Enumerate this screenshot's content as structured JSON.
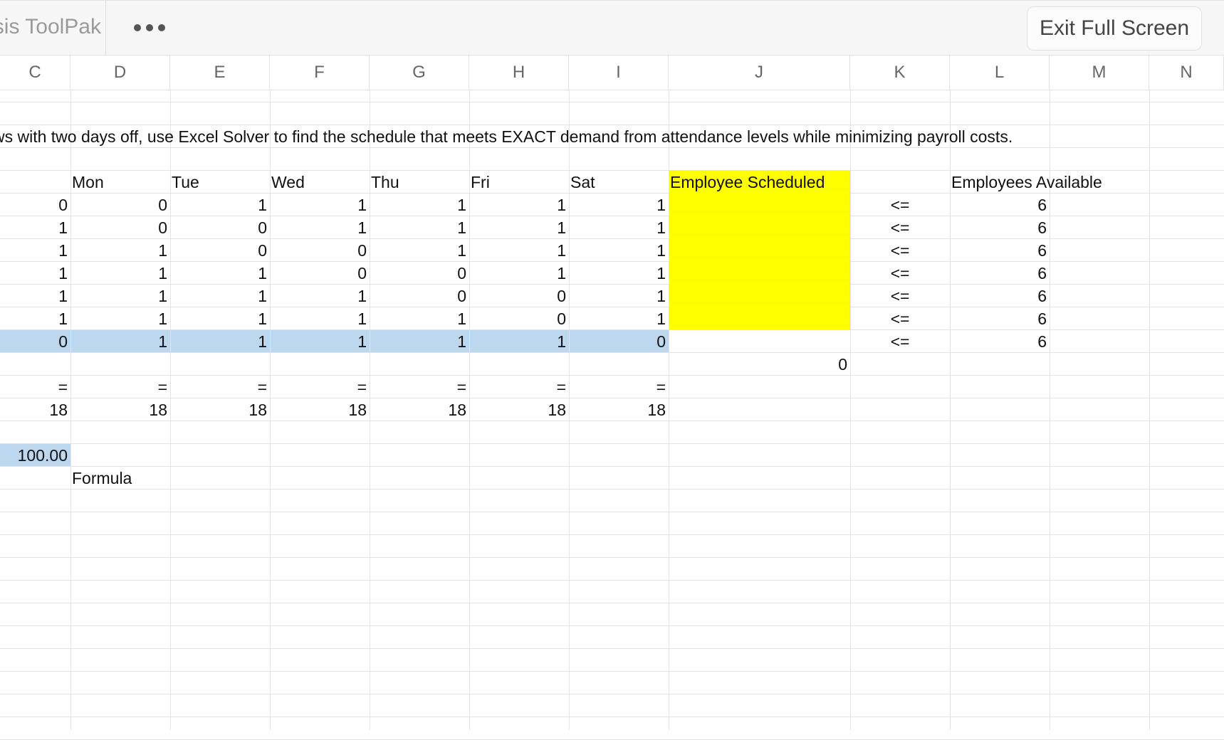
{
  "toolbar": {
    "tab_label": "Analysis ToolPak",
    "more_icon": "ellipsis-icon",
    "exit_full_screen_label": "Exit Full Screen"
  },
  "columns": [
    "C",
    "D",
    "E",
    "F",
    "G",
    "H",
    "I",
    "J",
    "K",
    "L",
    "M",
    "N"
  ],
  "sheet": {
    "instruction": "ws with two days off, use Excel Solver to find the schedule that meets EXACT demand from attendance levels while minimizing payroll costs.",
    "day_headers": [
      "Mon",
      "Tue",
      "Wed",
      "Thu",
      "Fri",
      "Sat"
    ],
    "scheduled_header": "Employee Scheduled",
    "available_header": "Employees Available",
    "matrix": [
      [
        "0",
        "0",
        "1",
        "1",
        "1",
        "1",
        "1"
      ],
      [
        "1",
        "0",
        "0",
        "1",
        "1",
        "1",
        "1"
      ],
      [
        "1",
        "1",
        "0",
        "0",
        "1",
        "1",
        "1"
      ],
      [
        "1",
        "1",
        "1",
        "0",
        "0",
        "1",
        "1"
      ],
      [
        "1",
        "1",
        "1",
        "1",
        "0",
        "0",
        "1"
      ],
      [
        "1",
        "1",
        "1",
        "1",
        "1",
        "0",
        "1"
      ],
      [
        "0",
        "1",
        "1",
        "1",
        "1",
        "1",
        "0"
      ]
    ],
    "constraint_ops": [
      "<=",
      "<=",
      "<=",
      "<=",
      "<=",
      "<=",
      "<="
    ],
    "available": [
      "6",
      "6",
      "6",
      "6",
      "6",
      "6",
      "6"
    ],
    "total_scheduled": "0",
    "equals_row": [
      "=",
      "=",
      "=",
      "=",
      "=",
      "=",
      "="
    ],
    "demand_row": [
      "18",
      "18",
      "18",
      "18",
      "18",
      "18",
      "18"
    ],
    "wage_value": "100.00",
    "formula_label": "Formula"
  },
  "colors": {
    "decision_fill": "#ffff00",
    "highlight_fill": "#bdd7ee"
  }
}
